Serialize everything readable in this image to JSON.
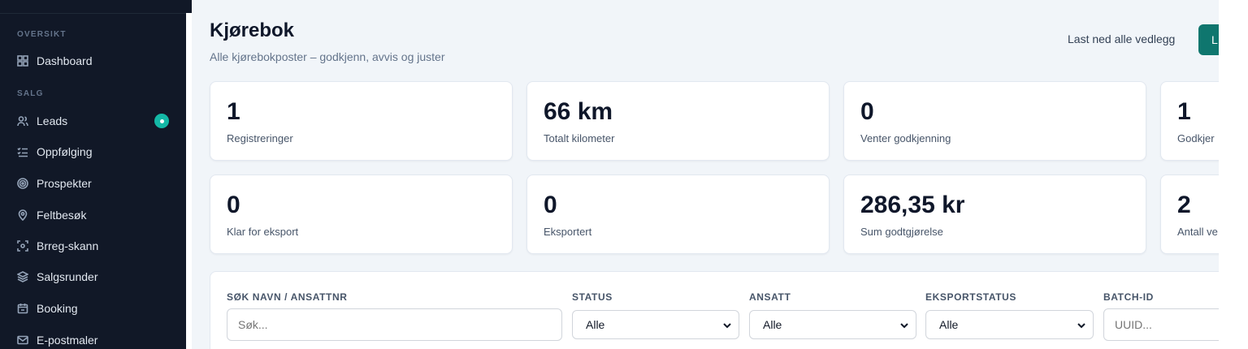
{
  "sidebar": {
    "sections": [
      {
        "label": "OVERSIKT"
      },
      {
        "label": "SALG"
      }
    ],
    "items": [
      {
        "label": "Dashboard",
        "icon": "grid-icon"
      },
      {
        "label": "Leads",
        "icon": "users-icon"
      },
      {
        "label": "Oppfølging",
        "icon": "checklist-icon"
      },
      {
        "label": "Prospekter",
        "icon": "target-icon"
      },
      {
        "label": "Feltbesøk",
        "icon": "map-pin-icon"
      },
      {
        "label": "Brreg-skann",
        "icon": "scan-icon"
      },
      {
        "label": "Salgsrunder",
        "icon": "layers-icon"
      },
      {
        "label": "Booking",
        "icon": "calendar-icon"
      },
      {
        "label": "E-postmaler",
        "icon": "mail-icon"
      }
    ]
  },
  "header": {
    "title": "Kjørebok",
    "subtitle": "Alle kjørebokposter – godkjenn, avvis og juster",
    "download_all": "Last ned alle vedlegg",
    "primary_button": "L"
  },
  "stats": [
    {
      "value": "1",
      "label": "Registreringer"
    },
    {
      "value": "66 km",
      "label": "Totalt kilometer"
    },
    {
      "value": "0",
      "label": "Venter godkjenning"
    },
    {
      "value": "1",
      "label": "Godkjer"
    },
    {
      "value": "0",
      "label": "Klar for eksport"
    },
    {
      "value": "0",
      "label": "Eksportert"
    },
    {
      "value": "286,35 kr",
      "label": "Sum godtgjørelse"
    },
    {
      "value": "2",
      "label": "Antall ve"
    }
  ],
  "filters": {
    "search": {
      "label": "SØK NAVN / ANSATTNR",
      "placeholder": "Søk..."
    },
    "status": {
      "label": "STATUS",
      "value": "Alle"
    },
    "employee": {
      "label": "ANSATT",
      "value": "Alle"
    },
    "export_status": {
      "label": "EKSPORTSTATUS",
      "value": "Alle"
    },
    "batch_id": {
      "label": "BATCH-ID",
      "placeholder": "UUID..."
    }
  },
  "colors": {
    "sidebar_bg": "#111827",
    "accent": "#0f766e",
    "badge": "#14b8a6",
    "main_bg": "#f1f5f9"
  }
}
